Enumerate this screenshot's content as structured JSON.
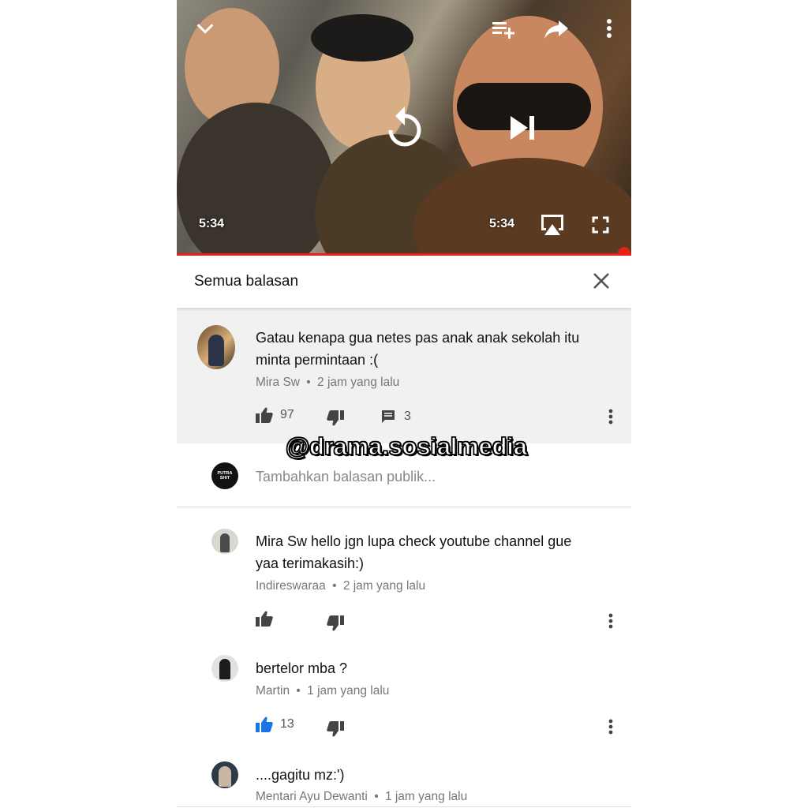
{
  "player": {
    "time_left": "5:34",
    "time_right": "5:34",
    "progress_percent": 98
  },
  "header": {
    "title": "Semua balasan"
  },
  "main_comment": {
    "text_line1": "Gatau kenapa gua netes pas anak anak sekolah itu",
    "text_line2": "minta permintaan :(",
    "author": "Mira Sw",
    "time": "2 jam yang lalu",
    "likes": "97",
    "replies": "3"
  },
  "watermark": "@drama.sosialmedia",
  "reply_input": {
    "placeholder": "Tambahkan balasan publik...",
    "avatar_text": "PUTRA SHIT"
  },
  "replies": [
    {
      "text_line1": "Mira Sw hello jgn lupa check youtube channel gue",
      "text_line2": "yaa terimakasih:)",
      "author": "Indireswaraa",
      "time": "2 jam yang lalu"
    },
    {
      "text_line1": "bertelor mba ?",
      "author": "Martin",
      "time": "1 jam yang lalu",
      "likes": "13"
    },
    {
      "text_line1": "....gagitu mz:')",
      "author": "Mentari Ayu Dewanti",
      "time": "1 jam yang lalu"
    }
  ],
  "separator": "•",
  "colors": {
    "progress": "#e62117",
    "liked": "#1a73e8",
    "highlight_bg": "#f1f1f1"
  },
  "icons": {
    "collapse": "chevron-down-icon",
    "add_to_playlist": "playlist-add-icon",
    "share": "share-icon",
    "more": "more-vert-icon",
    "replay": "replay-icon",
    "next": "skip-next-icon",
    "airplay": "airplay-icon",
    "fullscreen": "fullscreen-icon",
    "close": "close-icon",
    "like": "thumb-up-icon",
    "dislike": "thumb-down-icon",
    "reply": "comment-icon"
  }
}
